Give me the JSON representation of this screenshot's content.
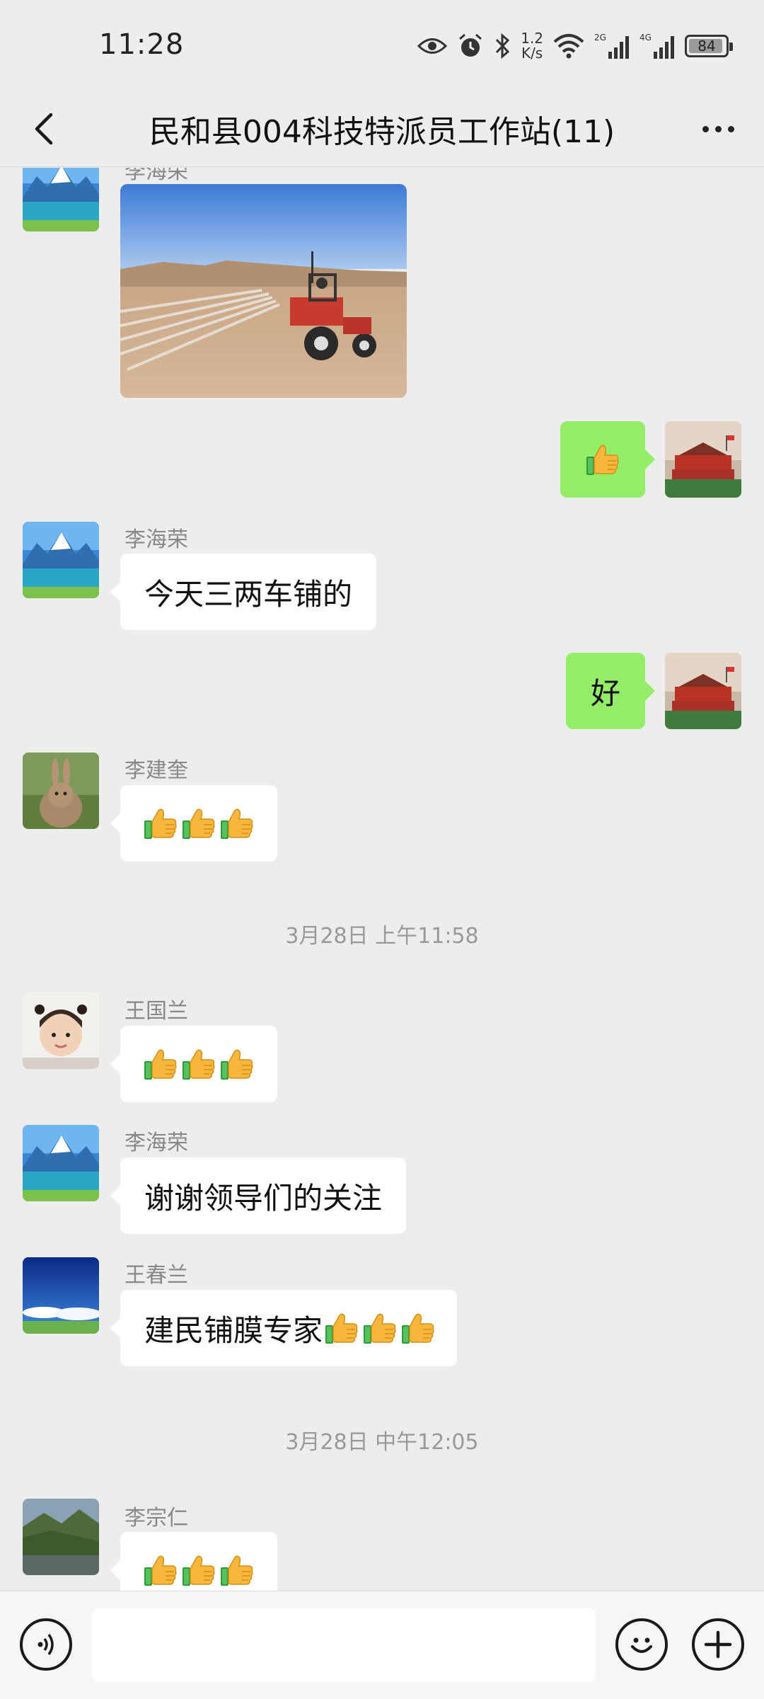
{
  "status_bar": {
    "time": "11:28",
    "speed_value": "1.2",
    "speed_unit": "K/s",
    "net_a": "2G",
    "net_b": "4G",
    "battery": "84"
  },
  "header": {
    "title": "民和县004科技特派员工作站(11)",
    "back_icon": "chevron-left-icon",
    "more_icon": "more-dots-icon"
  },
  "messages": [
    {
      "sender": "李海荣",
      "type": "image",
      "side": "left",
      "avatar": "mountain-lake"
    },
    {
      "sender": "me",
      "type": "emoji",
      "side": "right",
      "emoji_count": 1,
      "emoji": "thumbs-up"
    },
    {
      "sender": "李海荣",
      "type": "text",
      "side": "left",
      "text": "今天三两车铺的"
    },
    {
      "sender": "me",
      "type": "text",
      "side": "right",
      "text": "好"
    },
    {
      "sender": "李建奎",
      "type": "emoji",
      "side": "left",
      "emoji_count": 3,
      "emoji": "thumbs-up"
    },
    {
      "timestamp": "3月28日 上午11:58"
    },
    {
      "sender": "王国兰",
      "type": "emoji",
      "side": "left",
      "emoji_count": 3,
      "emoji": "thumbs-up"
    },
    {
      "sender": "李海荣",
      "type": "text",
      "side": "left",
      "text": "谢谢领导们的关注"
    },
    {
      "sender": "王春兰",
      "type": "text_emoji",
      "side": "left",
      "text": "建民铺膜专家",
      "emoji_count": 3,
      "emoji": "thumbs-up"
    },
    {
      "timestamp": "3月28日 中午12:05"
    },
    {
      "sender": "李宗仁",
      "type": "emoji",
      "side": "left",
      "emoji_count": 3,
      "emoji": "thumbs-up"
    }
  ],
  "input_bar": {
    "voice_icon": "voice-icon",
    "emoji_icon": "smiley-icon",
    "plus_icon": "plus-icon",
    "input_value": ""
  },
  "colors": {
    "background": "#EDEDED",
    "my_bubble": "#95EC69",
    "their_bubble": "#FFFFFF",
    "timestamp_text": "#999999"
  }
}
